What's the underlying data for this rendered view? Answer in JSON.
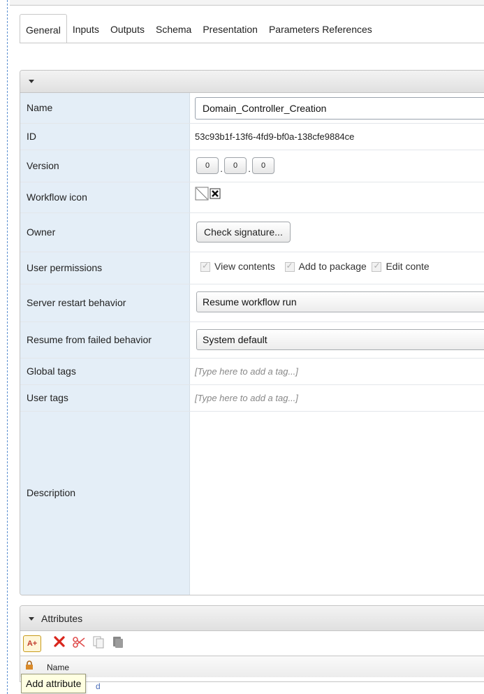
{
  "tabs": [
    {
      "label": "General",
      "active": true
    },
    {
      "label": "Inputs"
    },
    {
      "label": "Outputs"
    },
    {
      "label": "Schema"
    },
    {
      "label": "Presentation"
    },
    {
      "label": "Parameters References"
    }
  ],
  "general": {
    "name_label": "Name",
    "name_value": "Domain_Controller_Creation",
    "id_label": "ID",
    "id_value": "53c93b1f-13f6-4fd9-bf0a-138cfe9884ce",
    "version_label": "Version",
    "version": [
      "0",
      "0",
      "0"
    ],
    "version_sep": ".",
    "icon_label": "Workflow icon",
    "owner_label": "Owner",
    "owner_button": "Check signature...",
    "permissions_label": "User permissions",
    "permissions": [
      "View contents",
      "Add to package",
      "Edit conte"
    ],
    "restart_label": "Server restart behavior",
    "restart_value": "Resume workflow run",
    "resume_label": "Resume from failed behavior",
    "resume_value": "System default",
    "global_tags_label": "Global tags",
    "global_tags_placeholder": "[Type here to add a tag...]",
    "user_tags_label": "User tags",
    "user_tags_placeholder": "[Type here to add a tag...]",
    "description_label": "Description"
  },
  "attributes": {
    "title": "Attributes",
    "add_glyph": "A+",
    "column_name": "Name",
    "tooltip": "Add attribute",
    "tail_text": "d"
  },
  "colors": {
    "label_bg": "#e4eef7",
    "delete_red": "#d9251c",
    "focus_dash": "#5b8fd0"
  },
  "icons": [
    "dropdown-caret-icon",
    "workflow-image-icon",
    "clear-icon",
    "add-attribute-icon",
    "delete-icon",
    "cut-icon",
    "copy-icon",
    "paste-icon",
    "lock-icon"
  ]
}
